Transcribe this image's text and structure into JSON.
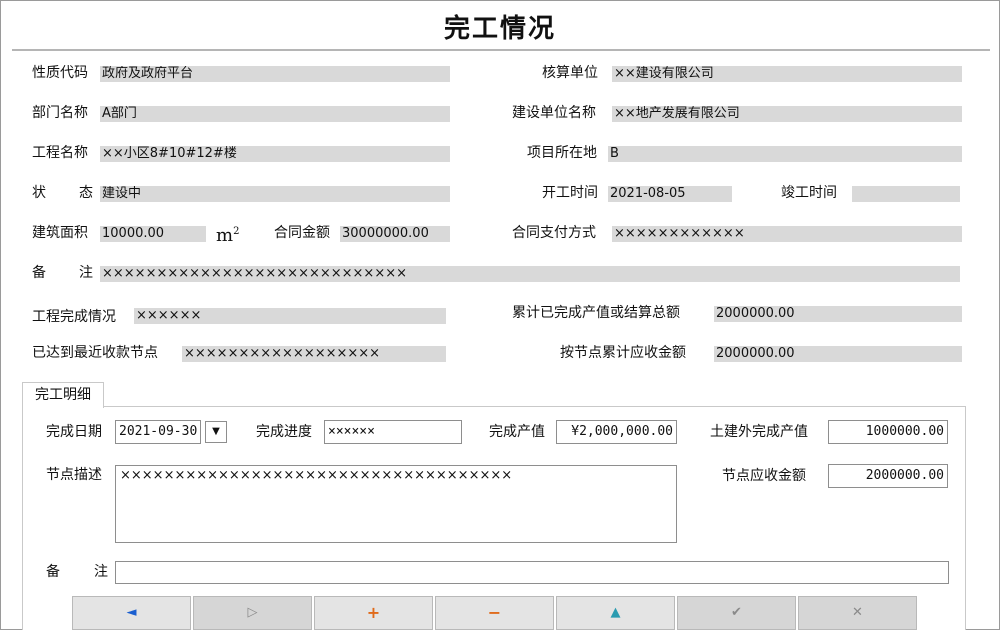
{
  "title": "完工情况",
  "form": {
    "nature_code_label": "性质代码",
    "nature_code_value": "政府及政府平台",
    "accounting_unit_label": "核算单位",
    "accounting_unit_value": "××建设有限公司",
    "dept_label": "部门名称",
    "dept_value": "A部门",
    "builder_label": "建设单位名称",
    "builder_value": "××地产发展有限公司",
    "project_label": "工程名称",
    "project_value": "××小区8#10#12#楼",
    "location_label": "项目所在地",
    "location_value": "B",
    "status_label_1": "状",
    "status_label_2": "态",
    "status_value": "建设中",
    "start_label": "开工时间",
    "start_value": "2021-08-05",
    "finish_label": "竣工时间",
    "finish_value": "",
    "area_label": "建筑面积",
    "area_value": "10000.00",
    "area_unit": "m",
    "area_unit_sup": "2",
    "contract_amount_label": "合同金额",
    "contract_amount_value": "30000000.00",
    "payment_method_label": "合同支付方式",
    "payment_method_value": "××××××××××××",
    "remark_label_1": "备",
    "remark_label_2": "注",
    "remark_value": "××××××××××××××××××××××××××××",
    "completion_label": "工程完成情况",
    "completion_value": "××××××",
    "cumulative_label": "累计已完成产值或结算总额",
    "cumulative_value": "2000000.00",
    "node_reached_label": "已达到最近收款节点",
    "node_reached_value": "××××××××××××××××××",
    "node_receivable_label": "按节点累计应收金额",
    "node_receivable_value": "2000000.00"
  },
  "detail": {
    "tab_label": "完工明细",
    "date_label": "完成日期",
    "date_value": "2021-09-30",
    "progress_label": "完成进度",
    "progress_value": "××××××",
    "output_label": "完成产值",
    "output_value": "¥2,000,000.00",
    "extra_output_label": "土建外完成产值",
    "extra_output_value": "1000000.00",
    "node_desc_label": "节点描述",
    "node_desc_value": "××××××××××××××××××××××××××××××××××××",
    "node_amount_label": "节点应收金额",
    "node_amount_value": "2000000.00",
    "remark_label_1": "备",
    "remark_label_2": "注",
    "remark_value": ""
  },
  "navigator": {
    "first": "◄",
    "next": "▷",
    "add": "+",
    "delete": "−",
    "up": "▲",
    "post": "✔",
    "cancel": "✕",
    "colors": {
      "blue": "#1a5fd0",
      "orange": "#e06a1a",
      "teal": "#2a9bb0",
      "gray": "#8a8a8a"
    }
  }
}
